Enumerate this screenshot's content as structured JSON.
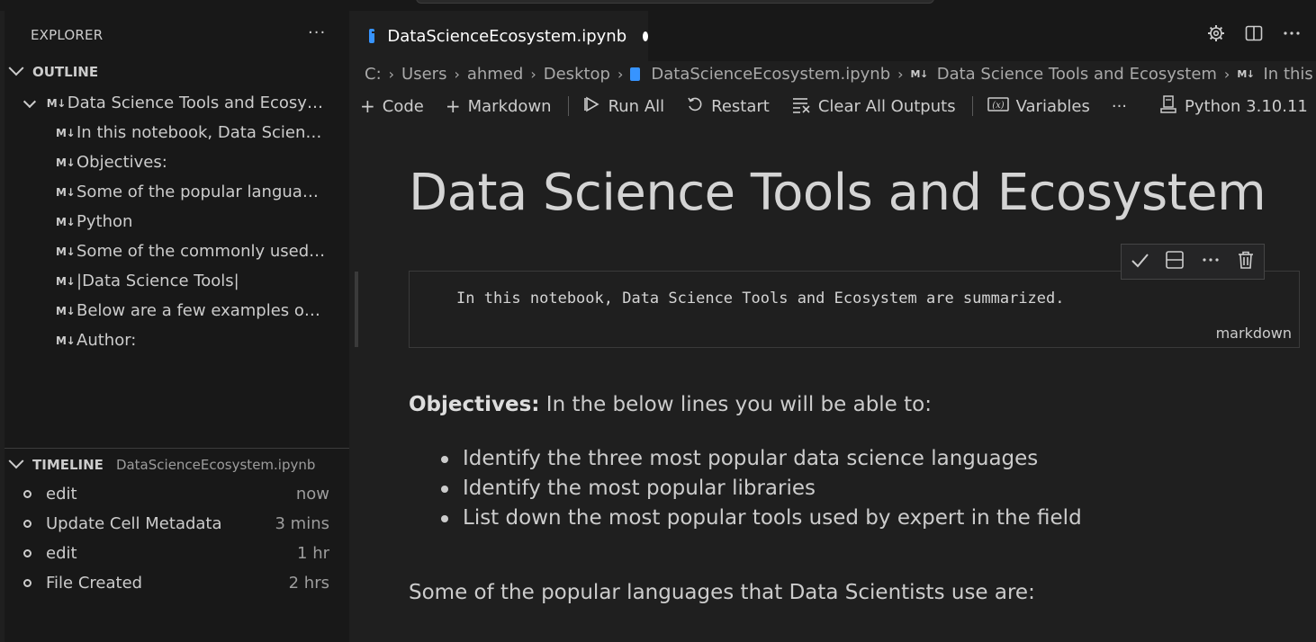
{
  "explorer": {
    "title": "EXPLORER",
    "more": "···"
  },
  "outline": {
    "header": "OUTLINE",
    "root": "Data Science Tools and Ecosyst...",
    "items": [
      "In this notebook, Data Science...",
      "Objectives:",
      "Some of the popular language...",
      "Python",
      "Some of the commonly used li...",
      "|Data Science Tools|",
      "Below are a few examples of e...",
      "Author:"
    ],
    "md_badge": "M↓"
  },
  "timeline": {
    "header": "TIMELINE",
    "file": "DataScienceEcosystem.ipynb",
    "entries": [
      {
        "label": "edit",
        "time": "now"
      },
      {
        "label": "Update Cell Metadata",
        "time": "3 mins"
      },
      {
        "label": "edit",
        "time": "1 hr"
      },
      {
        "label": "File Created",
        "time": "2 hrs"
      }
    ]
  },
  "tab": {
    "label": "DataScienceEcosystem.ipynb"
  },
  "breadcrumb": {
    "drive": "C:",
    "users": "Users",
    "user": "ahmed",
    "folder": "Desktop",
    "file": "DataScienceEcosystem.ipynb",
    "heading": "Data Science Tools and Ecosystem",
    "sub": "In this notebo"
  },
  "toolbar": {
    "code": "Code",
    "markdown": "Markdown",
    "run_all": "Run All",
    "restart": "Restart",
    "clear": "Clear All Outputs",
    "variables": "Variables",
    "more": "···",
    "kernel": "Python 3.10.11"
  },
  "notebook": {
    "heading": "Data Science Tools and Ecosystem",
    "cell_text": "In this notebook, Data Science Tools and Ecosystem are summarized.",
    "cell_lang": "markdown",
    "objectives_bold": "Objectives:",
    "objectives_rest": " In the below lines you will be able to:",
    "bullets": [
      "Identify the three most popular data science languages",
      "Identify the most popular libraries",
      "List down the most popular tools used by expert in the field"
    ],
    "languages_line": "Some of the popular languages that Data Scientists use are:"
  },
  "colors": {
    "accent": "#3794ff",
    "background": "#1f1f1f",
    "sidebar": "#181818"
  }
}
